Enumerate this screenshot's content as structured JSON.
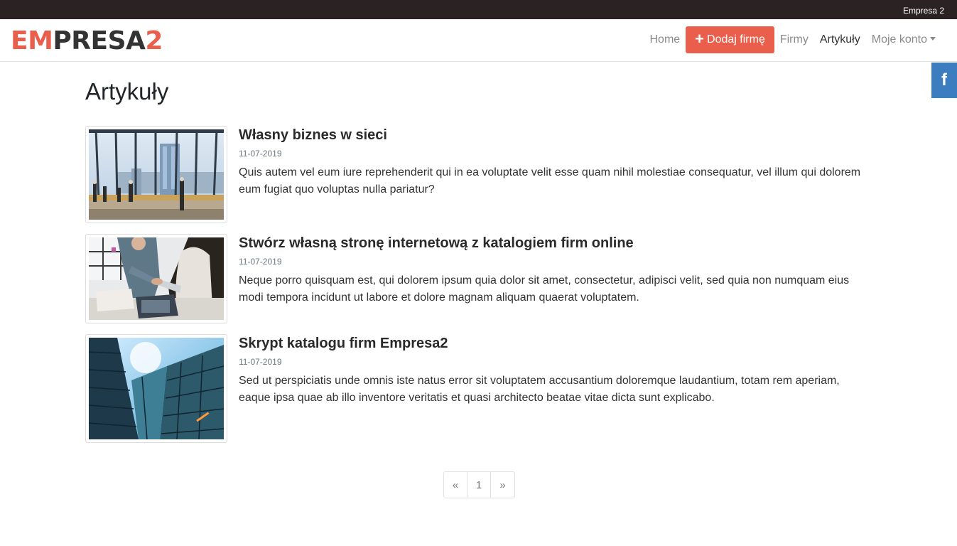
{
  "topbar": {
    "brand": "Empresa 2"
  },
  "logo": {
    "part1": "EM",
    "part2": "PRESA",
    "part3": "2"
  },
  "nav": {
    "home": "Home",
    "add_company": "Dodaj firmę",
    "companies": "Firmy",
    "articles": "Artykuły",
    "account": "Moje konto"
  },
  "social": {
    "facebook": "f"
  },
  "page": {
    "title": "Artykuły"
  },
  "articles": [
    {
      "title": "Własny biznes w sieci",
      "date": "11-07-2019",
      "text": "Quis autem vel eum iure reprehenderit qui in ea voluptate velit esse quam nihil molestiae consequatur, vel illum qui dolorem eum fugiat quo voluptas nulla pariatur?"
    },
    {
      "title": "Stwórz własną stronę internetową z katalogiem firm online",
      "date": "11-07-2019",
      "text": "Neque porro quisquam est, qui dolorem ipsum quia dolor sit amet, consectetur, adipisci velit, sed quia non numquam eius modi tempora incidunt ut labore et dolore magnam aliquam quaerat voluptatem."
    },
    {
      "title": "Skrypt katalogu firm Empresa2",
      "date": "11-07-2019",
      "text": "Sed ut perspiciatis unde omnis iste natus error sit voluptatem accusantium doloremque laudantium, totam rem aperiam, eaque ipsa quae ab illo inventore veritatis et quasi architecto beatae vitae dicta sunt explicabo."
    }
  ],
  "pagination": {
    "prev": "«",
    "current": "1",
    "next": "»"
  },
  "colors": {
    "accent": "#ea5f4b",
    "topbar": "#2b2323",
    "facebook": "#3b7dbe"
  }
}
